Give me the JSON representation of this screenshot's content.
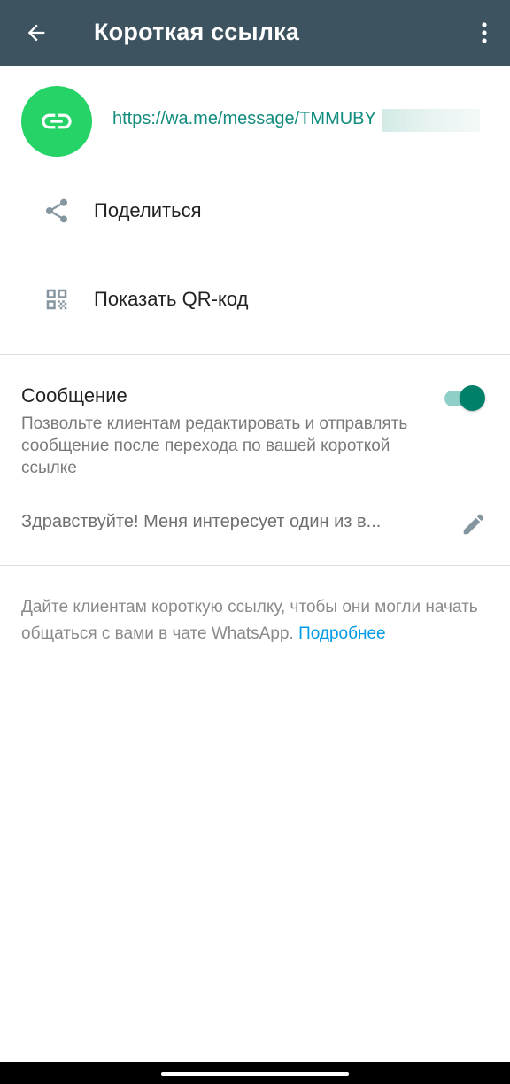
{
  "app_bar": {
    "title": "Короткая ссылка",
    "back_icon": "arrow-left-icon",
    "menu_icon": "more-vert-icon",
    "background": "#3d5360"
  },
  "short_link": {
    "url": "https://wa.me/message/TMMUBY",
    "icon": "link-icon",
    "avatar_color": "#25d366",
    "url_color": "#128c7e"
  },
  "actions": [
    {
      "label": "Поделиться",
      "icon": "share-icon"
    },
    {
      "label": "Показать QR-код",
      "icon": "qr-code-icon"
    }
  ],
  "message": {
    "title": "Сообщение",
    "description": "Позвольте клиентам редактировать и отправлять сообщение после перехода по вашей короткой ссылке",
    "toggle_on": true,
    "toggle_color": "#008069",
    "preview": "Здравствуйте! Меня интересует один из в...",
    "edit_icon": "pencil-icon"
  },
  "footer": {
    "text": "Дайте клиентам короткую ссылку, чтобы они могли начать общаться с вами в чате WhatsApp.",
    "link_label": "Подробнее",
    "link_color": "#039be5"
  }
}
